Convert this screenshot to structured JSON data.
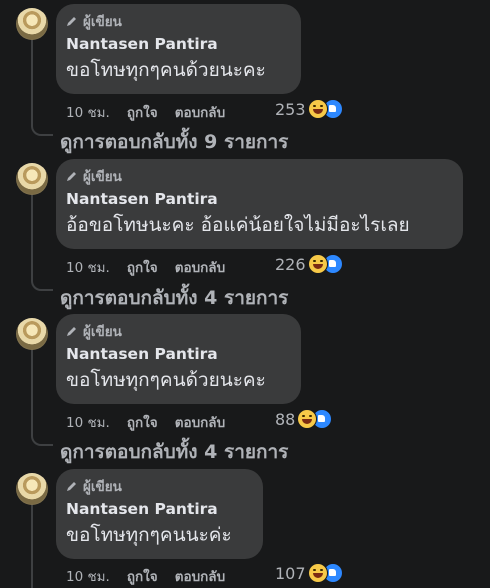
{
  "comments": [
    {
      "tag": "ผู้เขียน",
      "name": "Nantasen Pantira",
      "text": "ขอโทษทุกๆคนด้วยนะคะ",
      "time": "10 ชม.",
      "like": "ถูกใจ",
      "reply": "ตอบกลับ",
      "count": "253",
      "replies": "ดูการตอบกลับทั้ง 9 รายการ"
    },
    {
      "tag": "ผู้เขียน",
      "name": "Nantasen Pantira",
      "text": "อ้อขอโทษนะคะ อ้อแค่น้อยใจไม่มีอะไรเลย",
      "time": "10 ชม.",
      "like": "ถูกใจ",
      "reply": "ตอบกลับ",
      "count": "226",
      "replies": "ดูการตอบกลับทั้ง 4 รายการ"
    },
    {
      "tag": "ผู้เขียน",
      "name": "Nantasen Pantira",
      "text": "ขอโทษทุกๆคนด้วยนะคะ",
      "time": "10 ชม.",
      "like": "ถูกใจ",
      "reply": "ตอบกลับ",
      "count": "88",
      "replies": "ดูการตอบกลับทั้ง 4 รายการ"
    },
    {
      "tag": "ผู้เขียน",
      "name": "Nantasen Pantira",
      "text": "ขอโทษทุกๆคนนะค่ะ",
      "time": "10 ชม.",
      "like": "ถูกใจ",
      "reply": "ตอบกลับ",
      "count": "107"
    }
  ],
  "icons": {
    "author": "pencil-icon",
    "reactions": [
      "haha-reaction-icon",
      "like-reaction-icon"
    ]
  },
  "colors": {
    "background": "#18191a",
    "bubble": "#3a3b3c",
    "text": "#e4e6eb",
    "muted": "#b0b3b8",
    "like": "#2d88ff",
    "haha": "#f7c948"
  }
}
